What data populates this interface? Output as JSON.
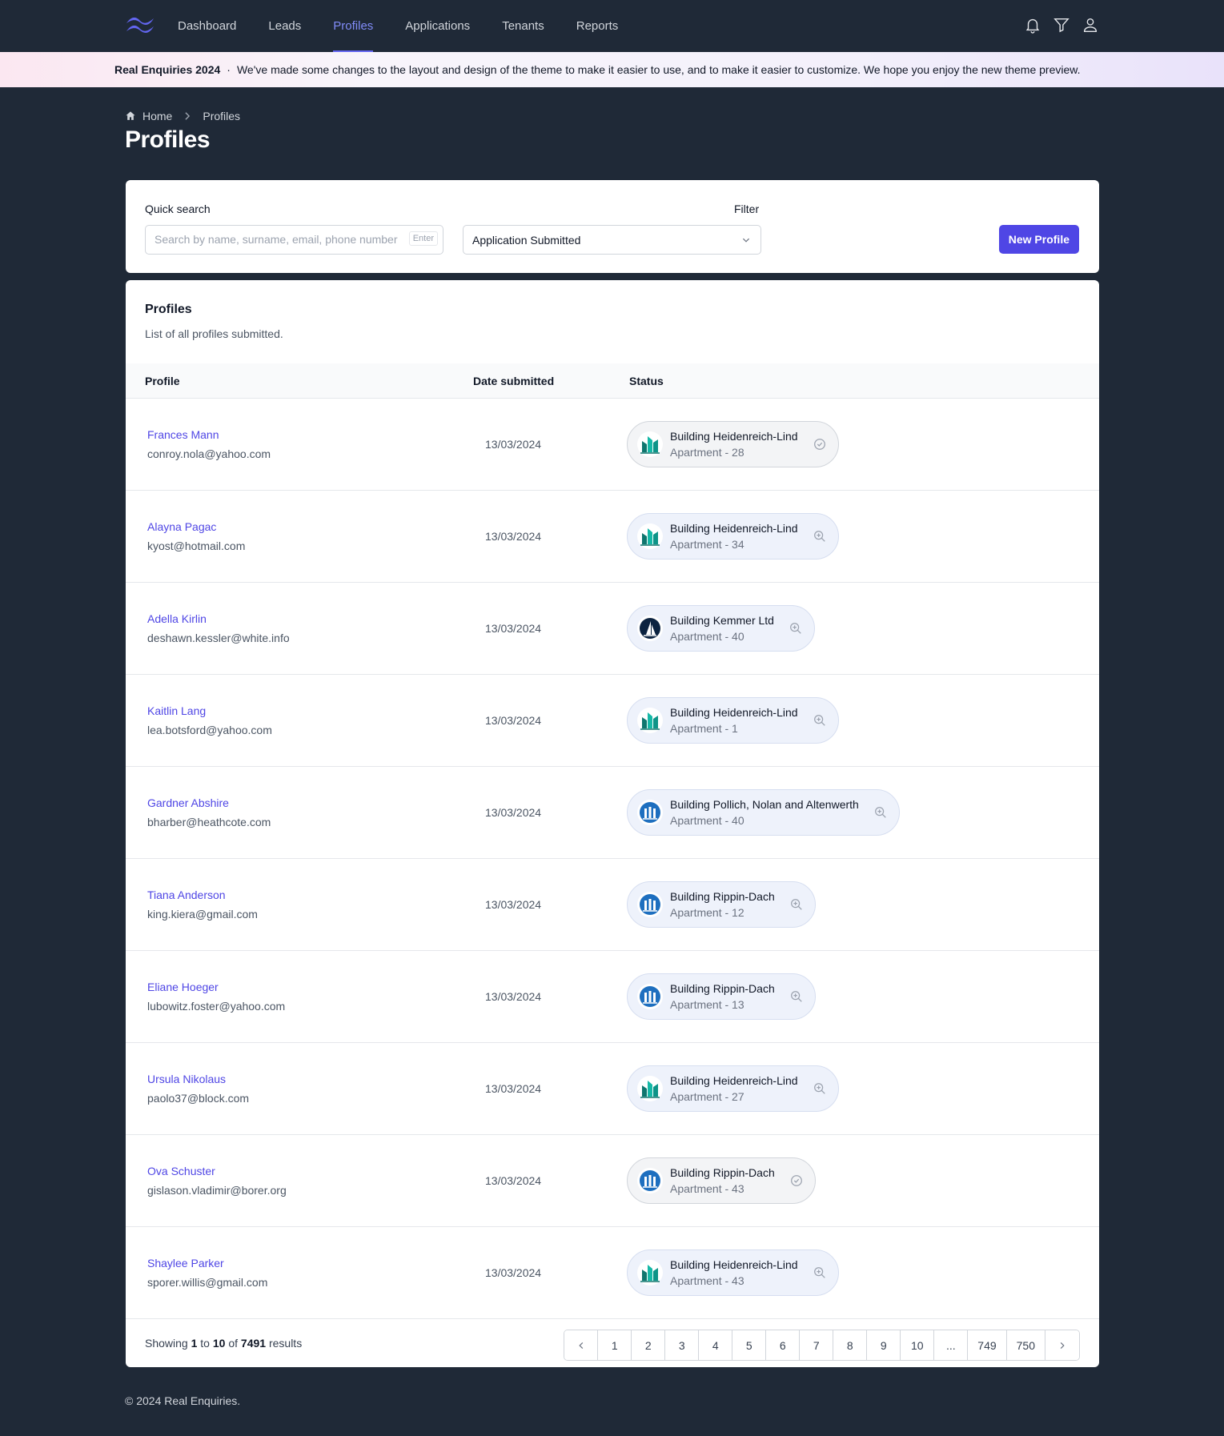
{
  "nav": {
    "items": [
      "Dashboard",
      "Leads",
      "Profiles",
      "Applications",
      "Tenants",
      "Reports"
    ],
    "active_index": 2,
    "icons": [
      "bell-icon",
      "filter-icon",
      "user-icon"
    ],
    "accent": "#6366f1"
  },
  "banner": {
    "title": "Real Enquiries 2024",
    "separator": "·",
    "message": "We've made some changes to the layout and design of the theme to make it easier to use, and to make it easier to customize. We hope you enjoy the new theme preview."
  },
  "breadcrumb": {
    "home": "Home",
    "current": "Profiles"
  },
  "page_title": "Profiles",
  "search": {
    "label": "Quick search",
    "placeholder": "Search by name, surname, email, phone number",
    "value": "",
    "shortcut": "Enter"
  },
  "filter": {
    "label": "Filter",
    "selected": "Application Submitted"
  },
  "new_button": "New Profile",
  "list": {
    "title": "Profiles",
    "subtitle": "List of all profiles submitted.",
    "columns": [
      "Profile",
      "Date submitted",
      "Status"
    ],
    "rows": [
      {
        "name": "Frances Mann",
        "email": "conroy.nola@yahoo.com",
        "date": "13/03/2024",
        "building": "Building Heidenreich-Lind",
        "apartment": "Apartment - 28",
        "logo": "heidenreich",
        "action": "check-circle-icon",
        "tone": "gray"
      },
      {
        "name": "Alayna Pagac",
        "email": "kyost@hotmail.com",
        "date": "13/03/2024",
        "building": "Building Heidenreich-Lind",
        "apartment": "Apartment - 34",
        "logo": "heidenreich",
        "action": "zoom-in-icon",
        "tone": "blue"
      },
      {
        "name": "Adella Kirlin",
        "email": "deshawn.kessler@white.info",
        "date": "13/03/2024",
        "building": "Building Kemmer Ltd",
        "apartment": "Apartment - 40",
        "logo": "kemmer",
        "action": "zoom-in-icon",
        "tone": "blue"
      },
      {
        "name": "Kaitlin Lang",
        "email": "lea.botsford@yahoo.com",
        "date": "13/03/2024",
        "building": "Building Heidenreich-Lind",
        "apartment": "Apartment - 1",
        "logo": "heidenreich",
        "action": "zoom-in-icon",
        "tone": "blue"
      },
      {
        "name": "Gardner Abshire",
        "email": "bharber@heathcote.com",
        "date": "13/03/2024",
        "building": "Building Pollich, Nolan and Altenwerth",
        "apartment": "Apartment - 40",
        "logo": "columns",
        "action": "zoom-in-icon",
        "tone": "blue"
      },
      {
        "name": "Tiana Anderson",
        "email": "king.kiera@gmail.com",
        "date": "13/03/2024",
        "building": "Building Rippin-Dach",
        "apartment": "Apartment - 12",
        "logo": "columns",
        "action": "zoom-in-icon",
        "tone": "blue"
      },
      {
        "name": "Eliane Hoeger",
        "email": "lubowitz.foster@yahoo.com",
        "date": "13/03/2024",
        "building": "Building Rippin-Dach",
        "apartment": "Apartment - 13",
        "logo": "columns",
        "action": "zoom-in-icon",
        "tone": "blue"
      },
      {
        "name": "Ursula Nikolaus",
        "email": "paolo37@block.com",
        "date": "13/03/2024",
        "building": "Building Heidenreich-Lind",
        "apartment": "Apartment - 27",
        "logo": "heidenreich",
        "action": "zoom-in-icon",
        "tone": "blue"
      },
      {
        "name": "Ova Schuster",
        "email": "gislason.vladimir@borer.org",
        "date": "13/03/2024",
        "building": "Building Rippin-Dach",
        "apartment": "Apartment - 43",
        "logo": "columns",
        "action": "check-circle-icon",
        "tone": "gray"
      },
      {
        "name": "Shaylee Parker",
        "email": "sporer.willis@gmail.com",
        "date": "13/03/2024",
        "building": "Building Heidenreich-Lind",
        "apartment": "Apartment - 43",
        "logo": "heidenreich",
        "action": "zoom-in-icon",
        "tone": "blue"
      }
    ]
  },
  "pagination": {
    "showing_prefix": "Showing",
    "from": "1",
    "to_word": "to",
    "to": "10",
    "of_word": "of",
    "total": "7491",
    "suffix": "results",
    "pages": [
      "1",
      "2",
      "3",
      "4",
      "5",
      "6",
      "7",
      "8",
      "9",
      "10",
      "...",
      "749",
      "750"
    ]
  },
  "footer": "© 2024 Real Enquiries."
}
